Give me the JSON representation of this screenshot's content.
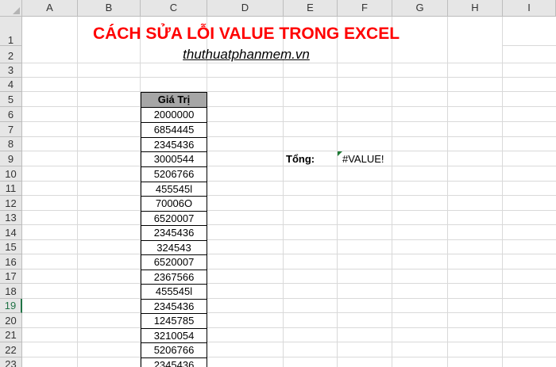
{
  "sheet": {
    "columns": [
      "A",
      "B",
      "C",
      "D",
      "E",
      "F",
      "G",
      "H",
      "I"
    ],
    "rows": [
      "1",
      "2",
      "3",
      "4",
      "5",
      "6",
      "7",
      "8",
      "9",
      "10",
      "11",
      "12",
      "13",
      "14",
      "15",
      "16",
      "17",
      "18",
      "19",
      "20",
      "21",
      "22",
      "23"
    ],
    "selected_row": "19"
  },
  "cells": {
    "title": "CÁCH SỬA LỖI VALUE TRONG EXCEL",
    "subtitle": "thuthuatphanmem.vn",
    "column_header": "Giá Trị",
    "values": [
      "2000000",
      "6854445",
      "2345436",
      "3000544",
      "5206766",
      "455545l",
      "70006O",
      "6520007",
      "2345436",
      "324543",
      "6520007",
      "2367566",
      "455545l",
      "2345436",
      "1245785",
      "3210054",
      "5206766",
      "2345436"
    ],
    "total_label": "Tổng:",
    "total_value": "#VALUE!"
  },
  "colors": {
    "title": "#ff0000",
    "header_fill": "#a6a6a6",
    "selection": "#217346",
    "error_indicator": "#1e7b34"
  }
}
